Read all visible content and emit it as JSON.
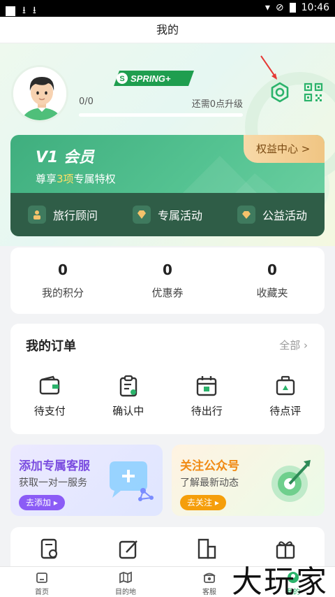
{
  "status": {
    "time": "10:46"
  },
  "header": {
    "title": "我的"
  },
  "profile": {
    "brand_logo": "SPRING+",
    "progress_text": "0/0",
    "progress_fraction": 0,
    "upgrade_text": "还需0点升级"
  },
  "vip": {
    "level": "V1 会员",
    "subtitle_pre": "尊享",
    "subtitle_highlight": "3项",
    "subtitle_post": "专属特权",
    "rights_button": "权益中心 >",
    "features": [
      {
        "icon": "travel-advisor-icon",
        "label": "旅行顾问"
      },
      {
        "icon": "diamond-icon",
        "label": "专属活动"
      },
      {
        "icon": "heart-diamond-icon",
        "label": "公益活动"
      }
    ]
  },
  "stats": [
    {
      "value": "0",
      "label": "我的积分"
    },
    {
      "value": "0",
      "label": "优惠券"
    },
    {
      "value": "0",
      "label": "收藏夹"
    }
  ],
  "orders": {
    "title": "我的订单",
    "all": "全部",
    "items": [
      {
        "icon": "wallet-icon",
        "label": "待支付"
      },
      {
        "icon": "clipboard-icon",
        "label": "确认中"
      },
      {
        "icon": "calendar-icon",
        "label": "待出行"
      },
      {
        "icon": "suitcase-icon",
        "label": "待点评"
      }
    ]
  },
  "promos": [
    {
      "title": "添加专属客服",
      "subtitle": "获取一对一服务",
      "button": "去添加 ▸"
    },
    {
      "title": "关注公众号",
      "subtitle": "了解最新动态",
      "button": "去关注 ▸"
    }
  ],
  "tabs": [
    {
      "icon": "home-icon",
      "label": "首页"
    },
    {
      "icon": "map-icon",
      "label": "目的地"
    },
    {
      "icon": "phone-icon",
      "label": "客服"
    },
    {
      "icon": "me-icon",
      "label": "我的"
    }
  ],
  "watermark": "大玩家",
  "colors": {
    "accent": "#2bb36b",
    "vip": "#3fae7e",
    "vip_strip": "#2f5d47",
    "rights": "#f0c583"
  }
}
